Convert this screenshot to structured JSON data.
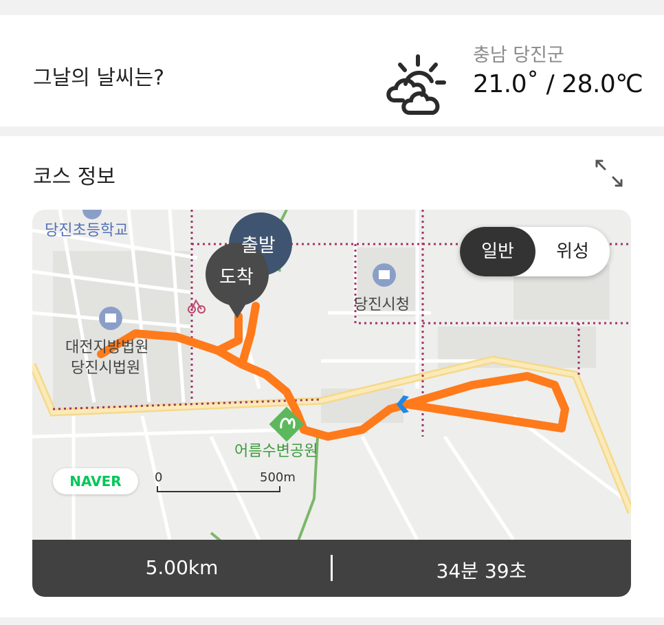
{
  "weather": {
    "title": "그날의 날씨는?",
    "icon": "partly-cloudy-icon",
    "location": "충남 당진군",
    "temperature": "21.0˚ / 28.0℃"
  },
  "course": {
    "title": "코스 정보",
    "expand_icon": "expand-icon",
    "map": {
      "labels": {
        "school": "당진초등학교",
        "city_hall": "당진시청",
        "court_line1": "대전지방법원",
        "court_line2": "당진시법원",
        "park": "어름수변공원"
      },
      "markers": {
        "start": "출발",
        "finish": "도착"
      },
      "toggle": {
        "normal": "일반",
        "satellite": "위성",
        "selected": "일반"
      },
      "provider": "NAVER",
      "scale": {
        "start": "0",
        "end": "500m"
      },
      "route_color": "#ff7a1a"
    },
    "stats": {
      "distance": "5.00km",
      "duration": "34분 39초"
    }
  }
}
